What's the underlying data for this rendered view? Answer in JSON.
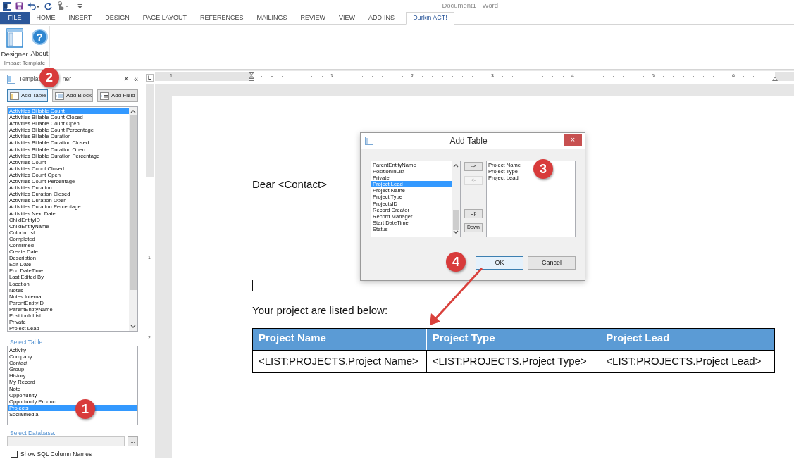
{
  "title_bar": {
    "title": "Document1 - Word"
  },
  "ribbon_tabs": [
    {
      "label": "FILE",
      "kind": "file",
      "selected": false
    },
    {
      "label": "HOME",
      "kind": "tab",
      "selected": false
    },
    {
      "label": "INSERT",
      "kind": "tab",
      "selected": false
    },
    {
      "label": "DESIGN",
      "kind": "tab",
      "selected": false
    },
    {
      "label": "PAGE LAYOUT",
      "kind": "tab",
      "selected": false
    },
    {
      "label": "REFERENCES",
      "kind": "tab",
      "selected": false
    },
    {
      "label": "MAILINGS",
      "kind": "tab",
      "selected": false
    },
    {
      "label": "REVIEW",
      "kind": "tab",
      "selected": false
    },
    {
      "label": "VIEW",
      "kind": "tab",
      "selected": false
    },
    {
      "label": "ADD-INS",
      "kind": "tab",
      "selected": false
    },
    {
      "label": "Durkin ACT!",
      "kind": "tab",
      "selected": true
    }
  ],
  "ribbon": {
    "buttons": [
      {
        "label": "Designer",
        "kind": "designer"
      },
      {
        "label": "About",
        "kind": "about",
        "icon_char": "?"
      }
    ],
    "group_label": "Impact Template"
  },
  "panel": {
    "title_parts": [
      "Templat",
      "ner"
    ],
    "close": "×",
    "collapse": "«",
    "buttons": [
      {
        "label": "Add Table",
        "kind": "table",
        "focused": true
      },
      {
        "label": "Add Block",
        "kind": "block",
        "focused": false
      },
      {
        "label": "Add Field",
        "kind": "field",
        "focused": false
      }
    ],
    "fields": [
      {
        "label": "Activities Billable Count",
        "selected": true
      },
      {
        "label": "Activities Billable Count Closed",
        "selected": false
      },
      {
        "label": "Activities Billable Count Open",
        "selected": false
      },
      {
        "label": "Activities Billable Count Percentage",
        "selected": false
      },
      {
        "label": "Activities Billable Duration",
        "selected": false
      },
      {
        "label": "Activities Billable Duration Closed",
        "selected": false
      },
      {
        "label": "Activities Billable Duration Open",
        "selected": false
      },
      {
        "label": "Activities Billable Duration Percentage",
        "selected": false
      },
      {
        "label": "Activities Count",
        "selected": false
      },
      {
        "label": "Activities Count Closed",
        "selected": false
      },
      {
        "label": "Activities Count Open",
        "selected": false
      },
      {
        "label": "Activities Count Percentage",
        "selected": false
      },
      {
        "label": "Activities Duration",
        "selected": false
      },
      {
        "label": "Activities Duration Closed",
        "selected": false
      },
      {
        "label": "Activities Duration Open",
        "selected": false
      },
      {
        "label": "Activities Duration Percentage",
        "selected": false
      },
      {
        "label": "Activities Next Date",
        "selected": false
      },
      {
        "label": "ChildEntityID",
        "selected": false
      },
      {
        "label": "ChildEntityName",
        "selected": false
      },
      {
        "label": "ColorInList",
        "selected": false
      },
      {
        "label": "Completed",
        "selected": false
      },
      {
        "label": "Confirmed",
        "selected": false
      },
      {
        "label": "Create Date",
        "selected": false
      },
      {
        "label": "Description",
        "selected": false
      },
      {
        "label": "Edit Date",
        "selected": false
      },
      {
        "label": "End DateTime",
        "selected": false
      },
      {
        "label": "Last Edited By",
        "selected": false
      },
      {
        "label": "Location",
        "selected": false
      },
      {
        "label": "Notes",
        "selected": false
      },
      {
        "label": "Notes Internal",
        "selected": false
      },
      {
        "label": "ParentEntityID",
        "selected": false
      },
      {
        "label": "ParentEntityName",
        "selected": false
      },
      {
        "label": "PositionInList",
        "selected": false
      },
      {
        "label": "Private",
        "selected": false
      },
      {
        "label": "Project Lead",
        "selected": false
      }
    ],
    "table_label": "Select Table:",
    "tables": [
      {
        "label": "Activity",
        "selected": false
      },
      {
        "label": "Company",
        "selected": false
      },
      {
        "label": "Contact",
        "selected": false
      },
      {
        "label": "Group",
        "selected": false
      },
      {
        "label": "History",
        "selected": false
      },
      {
        "label": "My Record",
        "selected": false
      },
      {
        "label": "Note",
        "selected": false
      },
      {
        "label": "Opportunity",
        "selected": false
      },
      {
        "label": "Opportunity Product",
        "selected": false
      },
      {
        "label": "Projects",
        "selected": true
      },
      {
        "label": "Socialmedia",
        "selected": false
      }
    ],
    "database_label": "Select Database:",
    "browse": "...",
    "show_sql": {
      "label": "Show SQL Column Names",
      "checked": false
    }
  },
  "ruler": {
    "numbers": [
      "1",
      "1",
      "2",
      "3",
      "4",
      "5",
      "6"
    ],
    "vertical_numbers": [
      "1",
      "2"
    ]
  },
  "document": {
    "greeting": "Dear <Contact>",
    "intro": "Your project are listed below:",
    "table": {
      "columns": [
        "Project Name",
        "Project Type",
        "Project Lead"
      ],
      "rows": [
        [
          "<LIST:PROJECTS.Project Name>",
          "<LIST:PROJECTS.Project Type>",
          "<LIST:PROJECTS.Project Lead>"
        ]
      ]
    }
  },
  "dialog": {
    "title": "Add Table",
    "close": "×",
    "available": [
      {
        "label": "ParentEntityName",
        "selected": false
      },
      {
        "label": "PositionInList",
        "selected": false
      },
      {
        "label": "Private",
        "selected": false
      },
      {
        "label": "Project Lead",
        "selected": true
      },
      {
        "label": "Project Name",
        "selected": false
      },
      {
        "label": "Project Type",
        "selected": false
      },
      {
        "label": "ProjectsID",
        "selected": false
      },
      {
        "label": "Record Creator",
        "selected": false
      },
      {
        "label": "Record Manager",
        "selected": false
      },
      {
        "label": "Start DateTime",
        "selected": false
      },
      {
        "label": "Status",
        "selected": false
      }
    ],
    "move_buttons": [
      {
        "label": "->",
        "disabled": false
      },
      {
        "label": "<-",
        "disabled": true
      },
      {
        "label": "Up",
        "disabled": false
      },
      {
        "label": "Down",
        "disabled": false
      }
    ],
    "chosen": [
      "Project Name",
      "Project Type",
      "Project Lead"
    ],
    "buttons": [
      {
        "label": "OK",
        "focused": true
      },
      {
        "label": "Cancel",
        "focused": false
      }
    ]
  },
  "annotations": [
    {
      "label": "2"
    },
    {
      "label": "1"
    },
    {
      "label": "3"
    },
    {
      "label": "4"
    }
  ]
}
